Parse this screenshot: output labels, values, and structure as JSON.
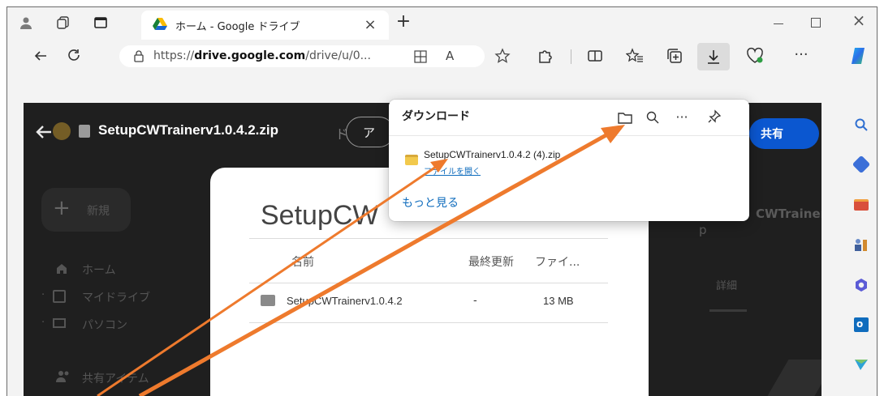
{
  "browser": {
    "tab_title": "ホーム - Google ドライブ",
    "url": "https://drive.google.com/drive/u/0...",
    "url_bold": "drive.google.com",
    "url_prefix": "https://",
    "url_suffix": "/drive/u/0...",
    "text_mode": "A"
  },
  "drive": {
    "file_title": "SetupCWTrainerv1.0.4.2.zip",
    "header_partial_btn": "ア",
    "partial_char": "ド",
    "share_label": "共有",
    "new_label": "新規",
    "nav": [
      {
        "label": "ホーム"
      },
      {
        "label": "マイドライブ"
      },
      {
        "label": "パソコン"
      },
      {
        "label": "共有アイテム"
      }
    ],
    "right_title": "CWTrainer",
    "right_sub": "p",
    "details_tab": "詳細"
  },
  "modal": {
    "title": "SetupCW",
    "columns": {
      "name": "名前",
      "modified": "最終更新",
      "size": "ファイ..."
    },
    "row": {
      "name": "SetupCWTrainerv1.0.4.2",
      "modified": "-",
      "size": "13 MB"
    }
  },
  "downloads": {
    "title": "ダウンロード",
    "file_name": "SetupCWTrainerv1.0.4.2 (4).zip",
    "open_file": "ファイルを開く",
    "see_more": "もっと見る"
  },
  "colors": {
    "annotation_arrow": "#ee7a2d",
    "link": "#0f6cbd",
    "share_button": "#0b57d0"
  }
}
